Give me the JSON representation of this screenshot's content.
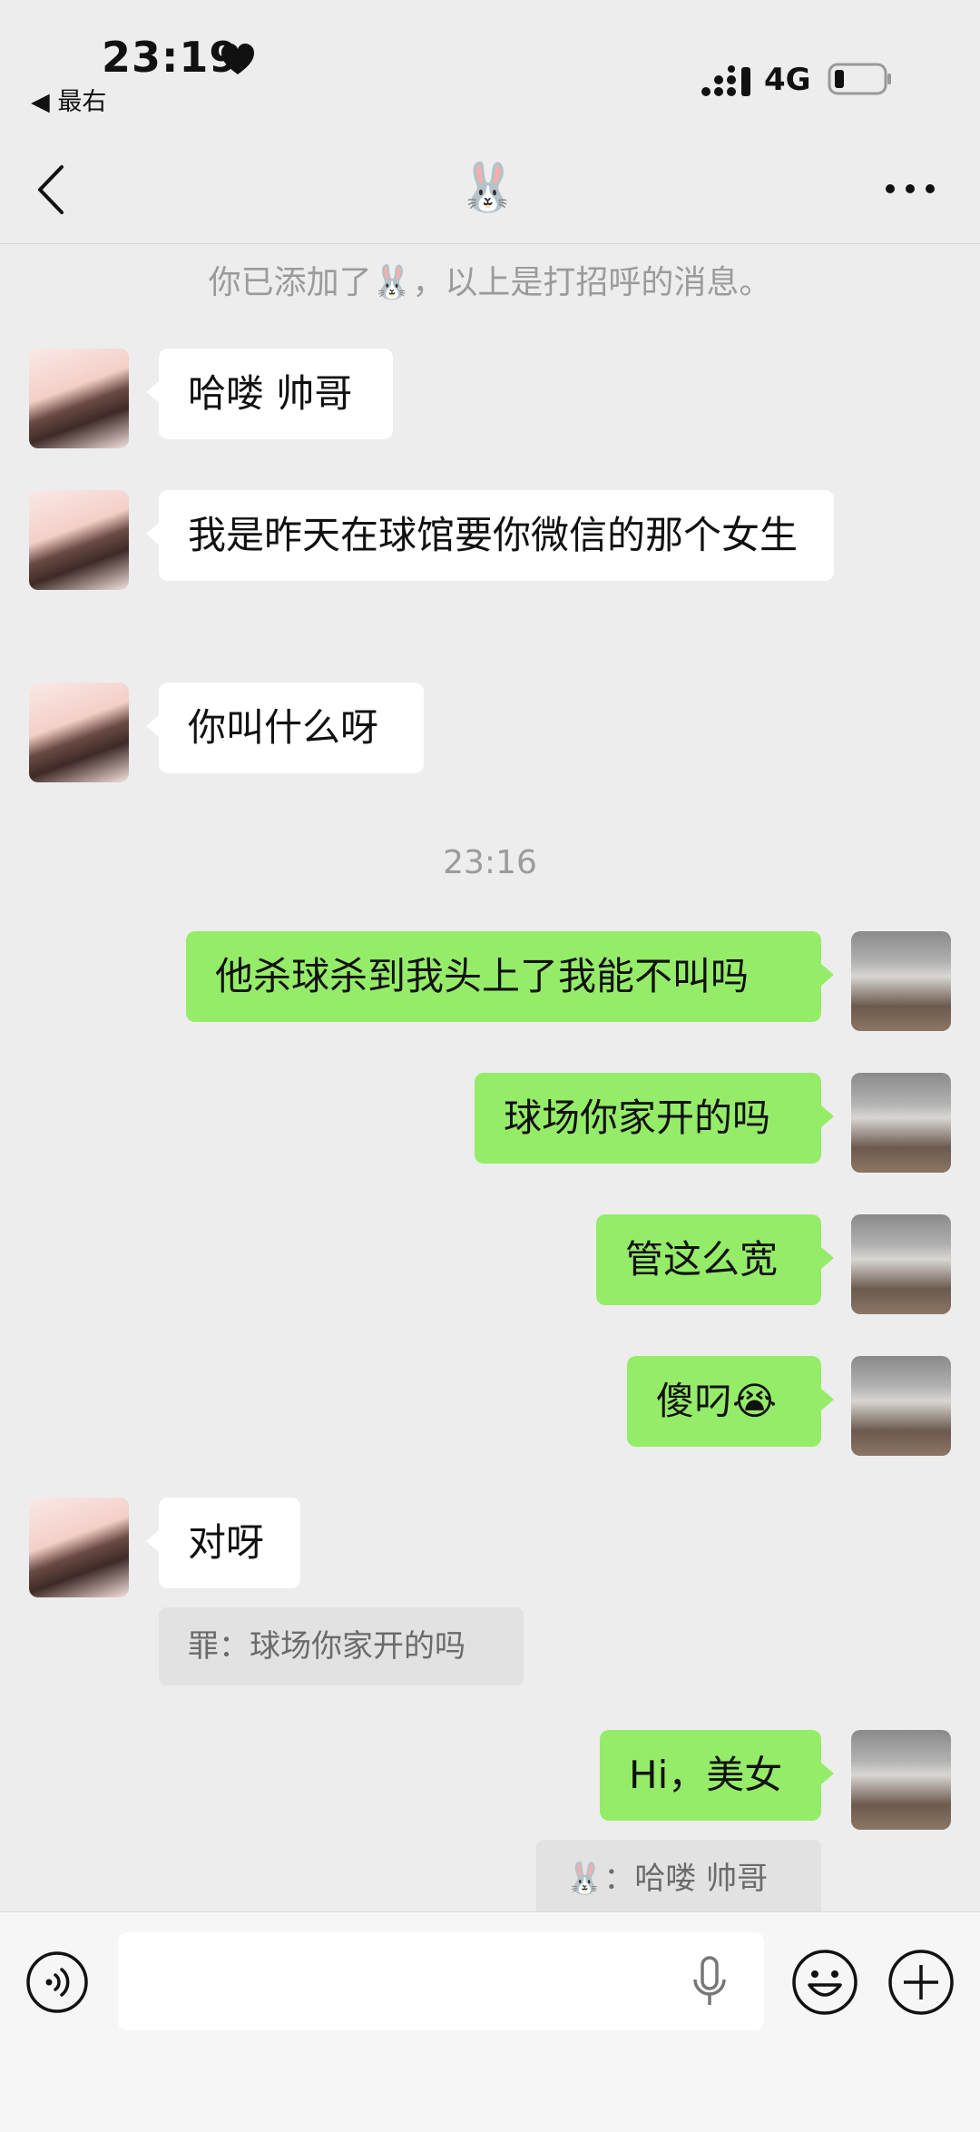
{
  "status_bar": {
    "time": "23:19",
    "back_app": "◀ 最右",
    "network": "4G"
  },
  "nav": {
    "title": "🐰"
  },
  "system_note": "你已添加了🐰，以上是打招呼的消息。",
  "timestamp": "23:16",
  "messages": [
    {
      "side": "in",
      "text": "哈喽 帅哥"
    },
    {
      "side": "in",
      "text": "我是昨天在球馆要你微信的那个女生"
    },
    {
      "side": "in",
      "text": "你叫什么呀"
    },
    {
      "side": "out",
      "text": "他杀球杀到我头上了我能不叫吗"
    },
    {
      "side": "out",
      "text": "球场你家开的吗"
    },
    {
      "side": "out",
      "text": "管这么宽"
    },
    {
      "side": "out",
      "text": "傻叼😭"
    },
    {
      "side": "in",
      "text": "对呀"
    },
    {
      "side": "out",
      "text": "Hi，美女"
    }
  ],
  "quotes": [
    {
      "text": "罪：球场你家开的吗"
    },
    {
      "text": "🐰：哈喽 帅哥"
    }
  ],
  "input": {
    "placeholder": ""
  }
}
